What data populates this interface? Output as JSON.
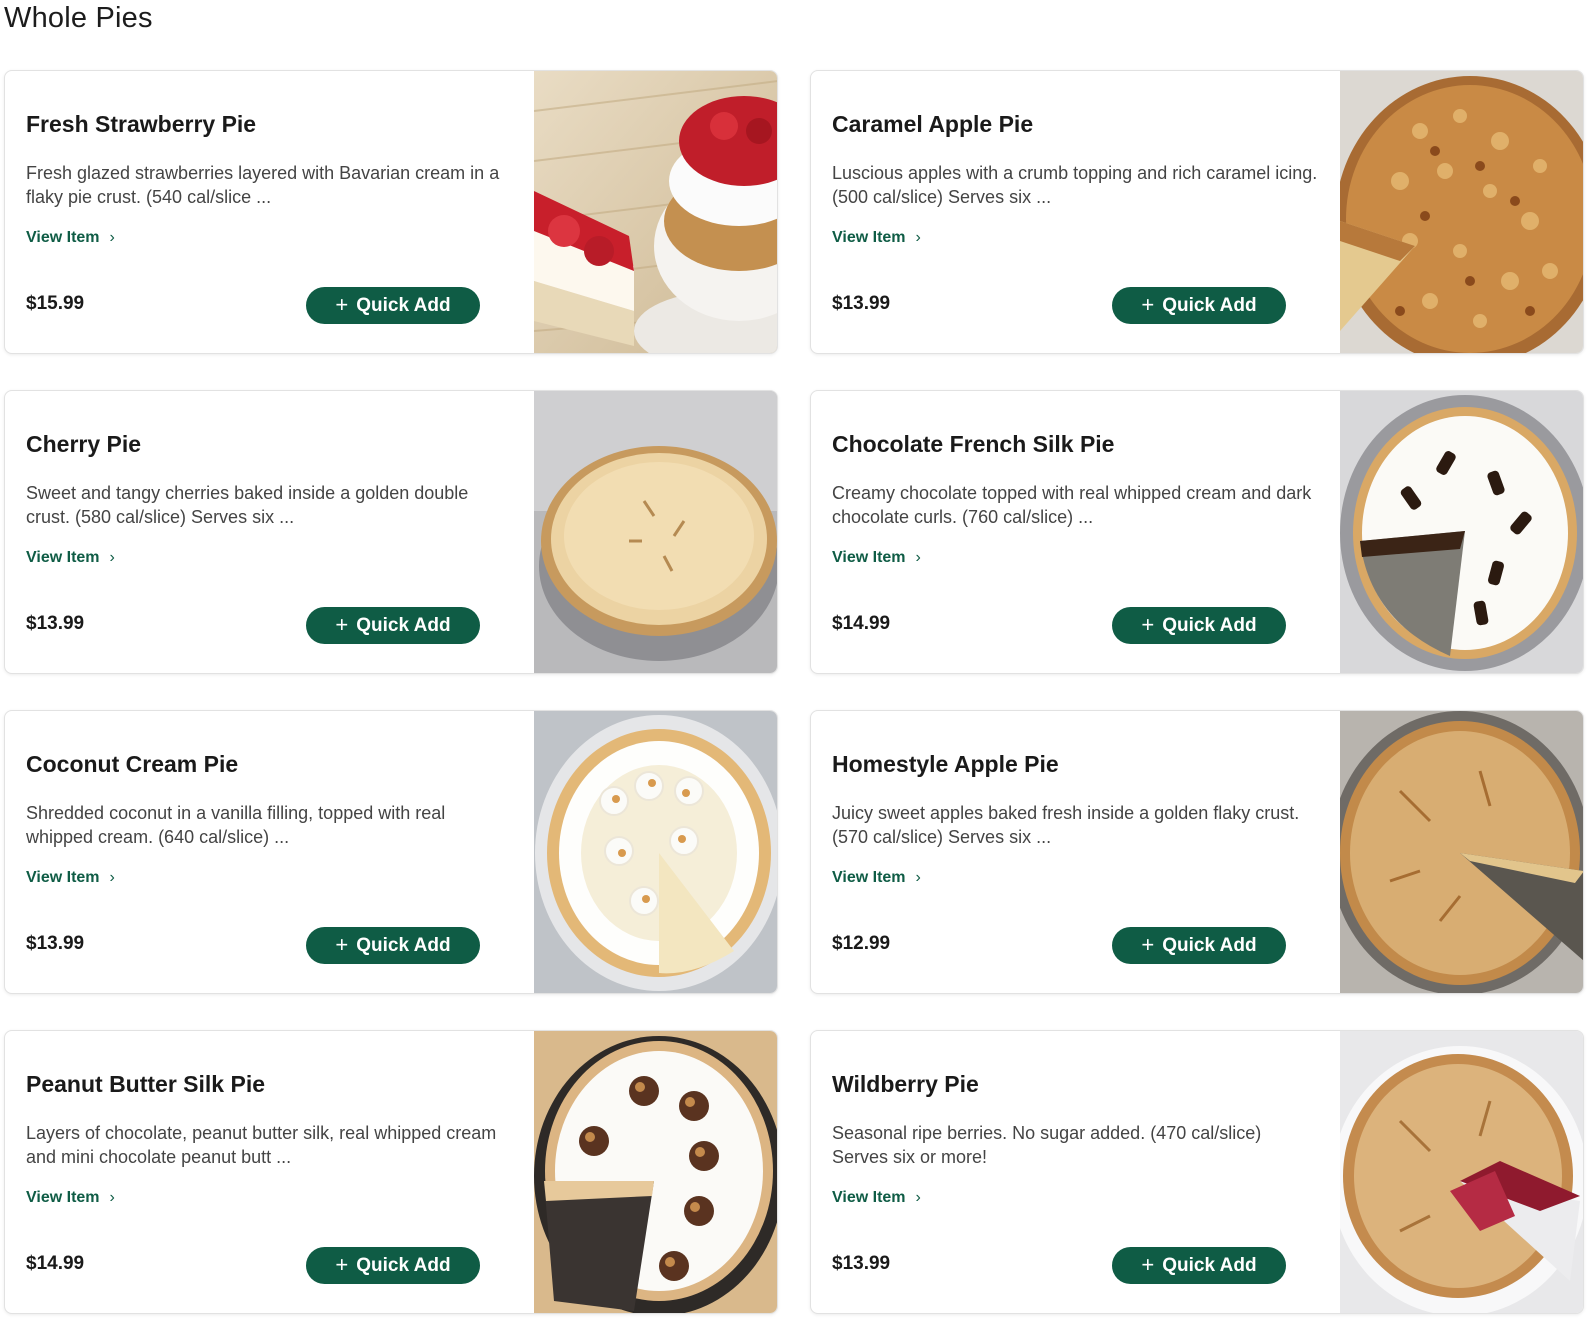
{
  "page_title": "Whole Pies",
  "view_label": "View Item",
  "quick_add_label": "Quick Add",
  "colors": {
    "brand_green": "#0f5c45"
  },
  "items": [
    {
      "name": "Fresh Strawberry Pie",
      "description": "Fresh glazed strawberries layered with Bavarian cream in a flaky pie crust. (540 cal/slice ...",
      "price": "$15.99",
      "image": "strawberry-pie-slice-image"
    },
    {
      "name": "Caramel Apple Pie",
      "description": "Luscious apples with a crumb topping and rich caramel icing. (500 cal/slice) Serves six ...",
      "price": "$13.99",
      "image": "caramel-apple-pie-image"
    },
    {
      "name": "Cherry Pie",
      "description": "Sweet and tangy cherries baked inside a golden double crust. (580 cal/slice) Serves six ...",
      "price": "$13.99",
      "image": "cherry-pie-image"
    },
    {
      "name": "Chocolate French Silk Pie",
      "description": "Creamy chocolate topped with real whipped cream and dark chocolate curls. (760 cal/slice) ...",
      "price": "$14.99",
      "image": "chocolate-french-silk-pie-image"
    },
    {
      "name": "Coconut Cream Pie",
      "description": "Shredded coconut in a vanilla filling, topped with real whipped cream. (640 cal/slice) ...",
      "price": "$13.99",
      "image": "coconut-cream-pie-image"
    },
    {
      "name": "Homestyle Apple Pie",
      "description": "Juicy sweet apples baked fresh inside a golden flaky crust. (570 cal/slice) Serves six ...",
      "price": "$12.99",
      "image": "homestyle-apple-pie-image"
    },
    {
      "name": "Peanut Butter Silk Pie",
      "description": "Layers of chocolate, peanut butter silk, real whipped cream and mini chocolate peanut butt ...",
      "price": "$14.99",
      "image": "peanut-butter-silk-pie-image"
    },
    {
      "name": "Wildberry Pie",
      "description": "Seasonal ripe berries. No sugar added. (470 cal/slice) Serves six or more!",
      "price": "$13.99",
      "image": "wildberry-pie-image"
    }
  ]
}
